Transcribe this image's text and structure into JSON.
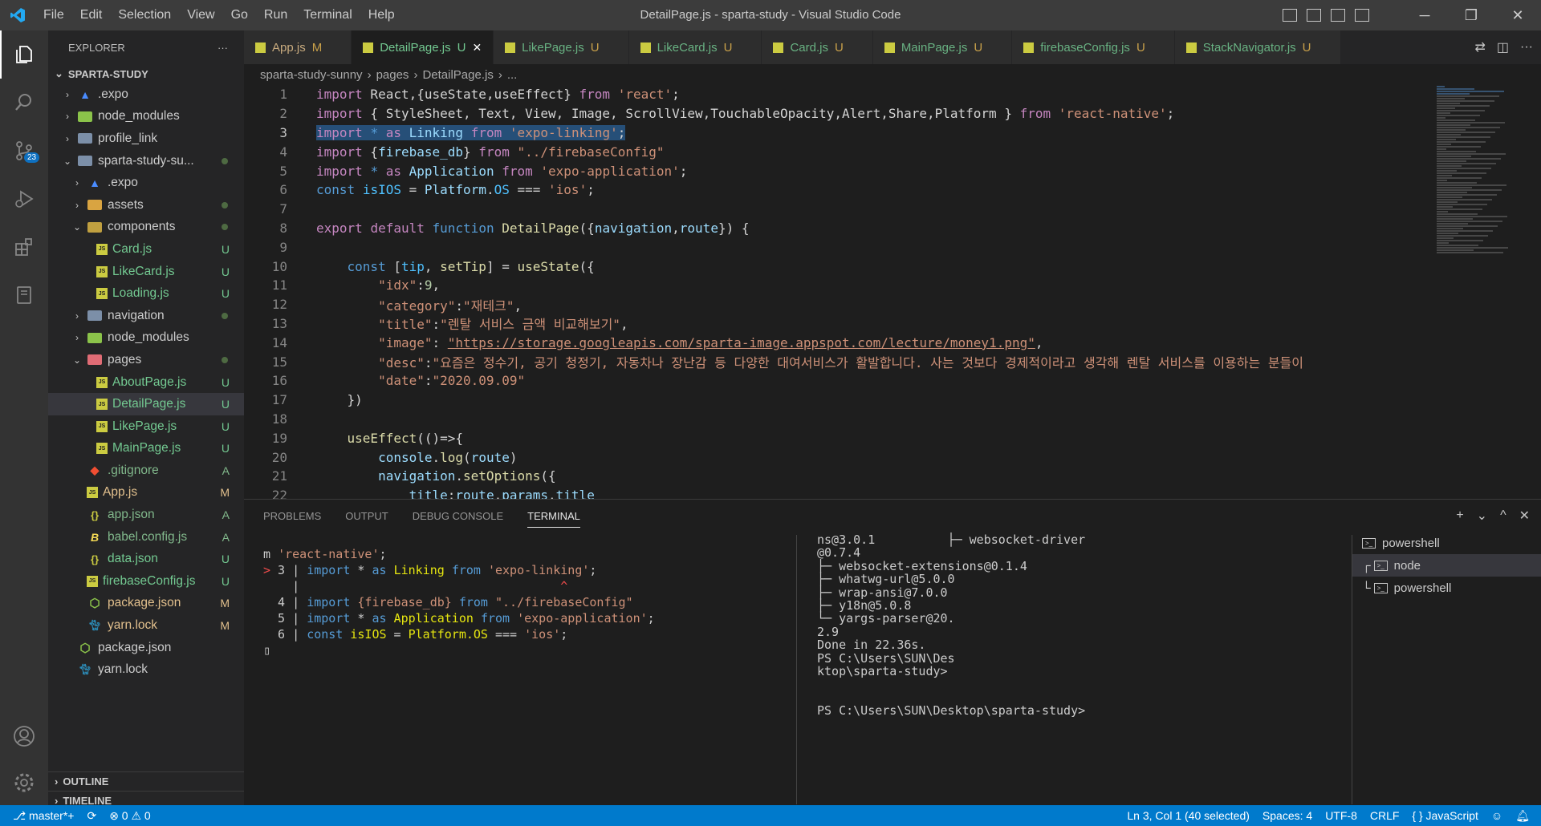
{
  "window": {
    "title": "DetailPage.js - sparta-study - Visual Studio Code",
    "menu": [
      "File",
      "Edit",
      "Selection",
      "View",
      "Go",
      "Run",
      "Terminal",
      "Help"
    ]
  },
  "activity_bar": {
    "scm_badge": "23"
  },
  "sidebar": {
    "header": "EXPLORER",
    "more": "···",
    "root": "SPARTA-STUDY",
    "items": [
      {
        "label": ".expo",
        "indent": 0,
        "kind": "folder-expo",
        "chev": "›",
        "status": ""
      },
      {
        "label": "node_modules",
        "indent": 0,
        "kind": "folder-node",
        "chev": "›",
        "status": ""
      },
      {
        "label": "profile_link",
        "indent": 0,
        "kind": "folder",
        "chev": "›",
        "status": ""
      },
      {
        "label": "sparta-study-su...",
        "indent": 0,
        "kind": "folder",
        "chev": "⌄",
        "status": "dot"
      },
      {
        "label": ".expo",
        "indent": 1,
        "kind": "folder-expo",
        "chev": "›",
        "status": ""
      },
      {
        "label": "assets",
        "indent": 1,
        "kind": "folder",
        "chev": "›",
        "status": "dot"
      },
      {
        "label": "components",
        "indent": 1,
        "kind": "folder",
        "chev": "⌄",
        "status": "dot"
      },
      {
        "label": "Card.js",
        "indent": 2,
        "kind": "js",
        "chev": "",
        "status": "U"
      },
      {
        "label": "LikeCard.js",
        "indent": 2,
        "kind": "js",
        "chev": "",
        "status": "U"
      },
      {
        "label": "Loading.js",
        "indent": 2,
        "kind": "js",
        "chev": "",
        "status": "U"
      },
      {
        "label": "navigation",
        "indent": 1,
        "kind": "folder",
        "chev": "›",
        "status": "dot"
      },
      {
        "label": "node_modules",
        "indent": 1,
        "kind": "folder-node",
        "chev": "›",
        "status": ""
      },
      {
        "label": "pages",
        "indent": 1,
        "kind": "folder",
        "chev": "⌄",
        "status": "dot"
      },
      {
        "label": "AboutPage.js",
        "indent": 2,
        "kind": "js",
        "chev": "",
        "status": "U"
      },
      {
        "label": "DetailPage.js",
        "indent": 2,
        "kind": "js",
        "chev": "",
        "status": "U",
        "selected": true
      },
      {
        "label": "LikePage.js",
        "indent": 2,
        "kind": "js",
        "chev": "",
        "status": "U"
      },
      {
        "label": "MainPage.js",
        "indent": 2,
        "kind": "js",
        "chev": "",
        "status": "U"
      },
      {
        "label": ".gitignore",
        "indent": 1,
        "kind": "git",
        "chev": "",
        "status": "A"
      },
      {
        "label": "App.js",
        "indent": 1,
        "kind": "js",
        "chev": "",
        "status": "M"
      },
      {
        "label": "app.json",
        "indent": 1,
        "kind": "json",
        "chev": "",
        "status": "A"
      },
      {
        "label": "babel.config.js",
        "indent": 1,
        "kind": "babel",
        "chev": "",
        "status": "A"
      },
      {
        "label": "data.json",
        "indent": 1,
        "kind": "json",
        "chev": "",
        "status": "U"
      },
      {
        "label": "firebaseConfig.js",
        "indent": 1,
        "kind": "js",
        "chev": "",
        "status": "U"
      },
      {
        "label": "package.json",
        "indent": 1,
        "kind": "npm",
        "chev": "",
        "status": "M"
      },
      {
        "label": "yarn.lock",
        "indent": 1,
        "kind": "yarn",
        "chev": "",
        "status": "M"
      },
      {
        "label": "package.json",
        "indent": 0,
        "kind": "npm",
        "chev": "",
        "status": ""
      },
      {
        "label": "yarn.lock",
        "indent": 0,
        "kind": "yarn",
        "chev": "",
        "status": ""
      }
    ],
    "outline": "OUTLINE",
    "timeline": "TIMELINE"
  },
  "tabs": [
    {
      "label": "App.js",
      "status": "M",
      "active": false
    },
    {
      "label": "DetailPage.js",
      "status": "U",
      "active": true,
      "close": "✕"
    },
    {
      "label": "LikePage.js",
      "status": "U",
      "active": false
    },
    {
      "label": "LikeCard.js",
      "status": "U",
      "active": false
    },
    {
      "label": "Card.js",
      "status": "U",
      "active": false
    },
    {
      "label": "MainPage.js",
      "status": "U",
      "active": false
    },
    {
      "label": "firebaseConfig.js",
      "status": "U",
      "active": false
    },
    {
      "label": "StackNavigator.js",
      "status": "U",
      "active": false
    }
  ],
  "breadcrumb": [
    "sparta-study-sunny",
    "pages",
    "DetailPage.js",
    "..."
  ],
  "editor": {
    "lines": [
      {
        "n": "1",
        "html": "<span class='kw'>import</span> React,{useState,useEffect} <span class='kw'>from</span> <span class='str'>'react'</span>;"
      },
      {
        "n": "2",
        "html": "<span class='kw'>import</span> { StyleSheet, Text, View, Image, ScrollView,TouchableOpacity,Alert,Share,Platform } <span class='kw'>from</span> <span class='str'>'react-native'</span>;"
      },
      {
        "n": "3",
        "html": "<span class='sel'><span class='kw'>import</span> <span class='kb'>*</span> <span class='kw'>as</span> <span class='var'>Linking</span> <span class='kw'>from</span> <span class='str'>'expo-linking'</span>;</span>"
      },
      {
        "n": "4",
        "html": "<span class='kw'>import</span> {<span class='var'>firebase_db</span>} <span class='kw'>from</span> <span class='str'>\"../firebaseConfig\"</span>"
      },
      {
        "n": "5",
        "html": "<span class='kw'>import</span> <span class='kb'>*</span> <span class='kw'>as</span> <span class='var'>Application</span> <span class='kw'>from</span> <span class='str'>'expo-application'</span>;"
      },
      {
        "n": "6",
        "html": "<span class='kb'>const</span> <span class='const'>isIOS</span> = <span class='var'>Platform</span>.<span class='const'>OS</span> === <span class='str'>'ios'</span>;"
      },
      {
        "n": "7",
        "html": ""
      },
      {
        "n": "8",
        "html": "<span class='kw'>export</span> <span class='kw'>default</span> <span class='kb'>function</span> <span class='fn'>DetailPage</span>({<span class='var'>navigation</span>,<span class='var'>route</span>}) {"
      },
      {
        "n": "9",
        "html": ""
      },
      {
        "n": "10",
        "html": "    <span class='kb'>const</span> [<span class='const'>tip</span>, <span class='fn'>setTip</span>] = <span class='fn'>useState</span>({"
      },
      {
        "n": "11",
        "html": "        <span class='str'>\"idx\"</span>:<span class='num'>9</span>,"
      },
      {
        "n": "12",
        "html": "        <span class='str'>\"category\"</span>:<span class='str'>\"재테크\"</span>,"
      },
      {
        "n": "13",
        "html": "        <span class='str'>\"title\"</span>:<span class='str'>\"렌탈 서비스 금액 비교해보기\"</span>,"
      },
      {
        "n": "14",
        "html": "        <span class='str'>\"image\"</span>: <span class='str' style='text-decoration:underline'>\"https://storage.googleapis.com/sparta-image.appspot.com/lecture/money1.png\"</span>,"
      },
      {
        "n": "15",
        "html": "        <span class='str'>\"desc\"</span>:<span class='str'>\"요즘은 정수기, 공기 청정기, 자동차나 장난감 등 다양한 대여서비스가 활발합니다. 사는 것보다 경제적이라고 생각해 렌탈 서비스를 이용하는 분들이</span>"
      },
      {
        "n": "16",
        "html": "        <span class='str'>\"date\"</span>:<span class='str'>\"2020.09.09\"</span>"
      },
      {
        "n": "17",
        "html": "    })"
      },
      {
        "n": "18",
        "html": ""
      },
      {
        "n": "19",
        "html": "    <span class='fn'>useEffect</span>(()=>{"
      },
      {
        "n": "20",
        "html": "        <span class='var'>console</span>.<span class='fn'>log</span>(<span class='var'>route</span>)"
      },
      {
        "n": "21",
        "html": "        <span class='var'>navigation</span>.<span class='fn'>setOptions</span>({"
      },
      {
        "n": "22",
        "html": "            <span class='var'>title</span>:<span class='var'>route</span>.<span class='var'>params</span>.<span class='var'>title</span>"
      }
    ]
  },
  "panel": {
    "tabs": [
      "PROBLEMS",
      "OUTPUT",
      "DEBUG CONSOLE",
      "TERMINAL"
    ],
    "active_tab": "TERMINAL",
    "actions": [
      "+",
      "⌄",
      "^",
      "✕"
    ],
    "left_terminal": [
      "m <span style='color:#ce9178'>'react-native'</span>;",
      "<span style='color:#f14c4c'>&gt;</span> 3 | <span style='color:#569cd6'>import</span> * <span style='color:#569cd6'>as</span> <span style='color:#e5e510'>Linking</span> <span style='color:#569cd6'>from</span> <span style='color:#ce9178'>'expo-linking'</span>;",
      "    |                                    <span style='color:#f14c4c'>^</span>",
      "  4 | <span style='color:#569cd6'>import</span> <span style='color:#ce9178'>{firebase_db}</span> <span style='color:#569cd6'>from</span> <span style='color:#ce9178'>\"../firebaseConfig\"</span>",
      "  5 | <span style='color:#569cd6'>import</span> * <span style='color:#569cd6'>as</span> <span style='color:#e5e510'>Application</span> <span style='color:#569cd6'>from</span> <span style='color:#ce9178'>'expo-application'</span>;",
      "  6 | <span style='color:#569cd6'>const</span> <span style='color:#e5e510'>isIOS</span> = <span style='color:#e5e510'>Platform.OS</span> === <span style='color:#ce9178'>'ios'</span>;",
      "▯"
    ],
    "right_terminal": [
      "ns@3.0.1          ├─ websocket-driver",
      "@0.7.4",
      "├─ websocket-extensions@0.1.4",
      "├─ whatwg-url@5.0.0",
      "├─ wrap-ansi@7.0.0",
      "├─ y18n@5.0.8",
      "└─ yargs-parser@20.",
      "2.9",
      "Done in 22.36s.",
      "PS C:\\Users\\SUN\\Des",
      "ktop\\sparta-study>",
      "",
      "",
      "PS C:\\Users\\SUN\\Desktop\\sparta-study>"
    ],
    "terminal_list": [
      {
        "label": "powershell",
        "prefix": "",
        "active": false
      },
      {
        "label": "node",
        "prefix": "┌",
        "active": true
      },
      {
        "label": "powershell",
        "prefix": "└",
        "active": false
      }
    ]
  },
  "statusbar": {
    "branch": "master*+",
    "sync": "⟳",
    "problems": "⊗ 0 ⚠ 0",
    "position": "Ln 3, Col 1 (40 selected)",
    "spaces": "Spaces: 4",
    "encoding": "UTF-8",
    "eol": "CRLF",
    "language": "{ } JavaScript"
  }
}
